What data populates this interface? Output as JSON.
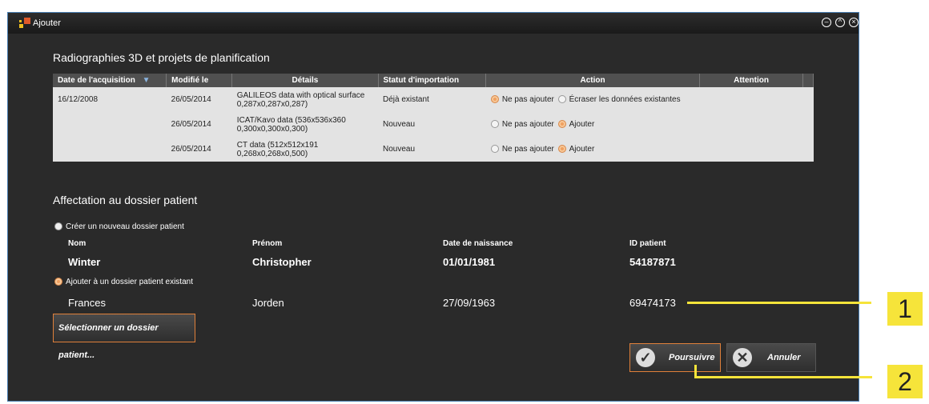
{
  "window": {
    "title": "Ajouter",
    "icon": "app-logo-icon"
  },
  "imports": {
    "title": "Radiographies 3D et projets de planification",
    "columns": [
      "Date de l'acquisition",
      "Modifié le",
      "Détails",
      "Statut d'importation",
      "Action",
      "Attention"
    ],
    "rows": [
      {
        "date": "16/12/2008",
        "modified": "26/05/2014",
        "details1": "GALILEOS data with optical surface",
        "details2": "0,287x0,287x0,287)",
        "status": "Déjà existant",
        "opt1": "Ne pas ajouter",
        "opt2": "Écraser les données existantes",
        "selected": 1
      },
      {
        "date": "",
        "modified": "26/05/2014",
        "details1": "ICAT/Kavo data (536x536x360",
        "details2": "0,300x0,300x0,300)",
        "status": "Nouveau",
        "opt1": "Ne pas ajouter",
        "opt2": "Ajouter",
        "selected": 2
      },
      {
        "date": "",
        "modified": "26/05/2014",
        "details1": "CT data (512x512x191",
        "details2": "0,268x0,268x0,500)",
        "status": "Nouveau",
        "opt1": "Ne pas ajouter",
        "opt2": "Ajouter",
        "selected": 2
      }
    ]
  },
  "assignment": {
    "title": "Affectation au dossier patient",
    "create_label": "Créer un nouveau dossier patient",
    "col_nom": "Nom",
    "col_prenom": "Prénom",
    "col_dob": "Date de naissance",
    "col_id": "ID patient",
    "new_patient": {
      "nom": "Winter",
      "prenom": "Christopher",
      "dob": "01/01/1981",
      "id": "54187871"
    },
    "existing_label": "Ajouter à un dossier patient existant",
    "existing_patient": {
      "nom": "Frances",
      "prenom": "Jorden",
      "dob": "27/09/1963",
      "id": "69474173"
    },
    "select_button": "Sélectionner un dossier patient..."
  },
  "buttons": {
    "continue": "Poursuivre",
    "cancel": "Annuler"
  },
  "callouts": {
    "one": "1",
    "two": "2"
  }
}
